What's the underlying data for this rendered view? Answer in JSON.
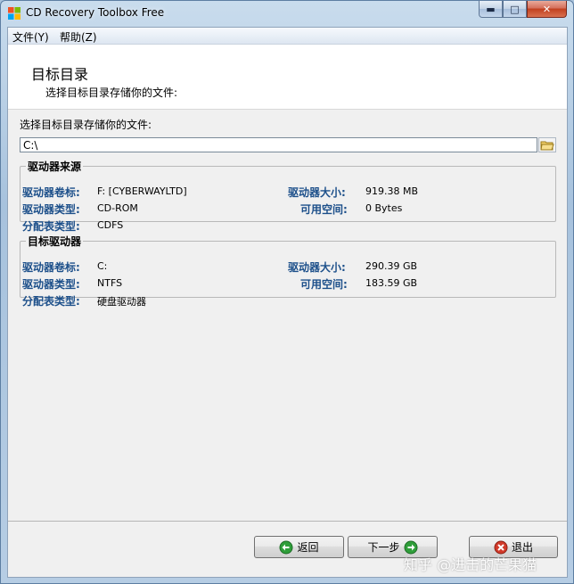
{
  "window": {
    "title": "CD Recovery Toolbox Free"
  },
  "window_buttons": {
    "minimize": "▬",
    "maximize": "□",
    "close": "✕"
  },
  "menu": [
    {
      "label": "文件(Y)"
    },
    {
      "label": "帮助(Z)"
    }
  ],
  "header": {
    "title": "目标目录",
    "subtitle": "选择目标目录存储你的文件:"
  },
  "target": {
    "label": "选择目标目录存储你的文件:",
    "path": "C:\\"
  },
  "source_drive": {
    "legend": "驱动器来源",
    "volume_label": "驱动器卷标:",
    "volume_value": "F: [CYBERWAYLTD]",
    "type_label": "驱动器类型:",
    "type_value": "CD-ROM",
    "fs_label": "分配表类型:",
    "fs_value": "CDFS",
    "size_label": "驱动器大小:",
    "size_value": "919.38 MB",
    "free_label": "可用空间:",
    "free_value": "0 Bytes"
  },
  "target_drive": {
    "legend": "目标驱动器",
    "volume_label": "驱动器卷标:",
    "volume_value": "C:",
    "type_label": "驱动器类型:",
    "type_value": "NTFS",
    "fs_label": "分配表类型:",
    "fs_value": "硬盘驱动器",
    "size_label": "驱动器大小:",
    "size_value": "290.39 GB",
    "free_label": "可用空间:",
    "free_value": "183.59 GB"
  },
  "buttons": {
    "back": "返回",
    "next": "下一步",
    "exit": "退出"
  },
  "colors": {
    "label_blue": "#1c4f8a",
    "icon_green": "#2f9e3a",
    "icon_red": "#d23a2a"
  },
  "watermark": "知乎 @进击的芒果猫"
}
